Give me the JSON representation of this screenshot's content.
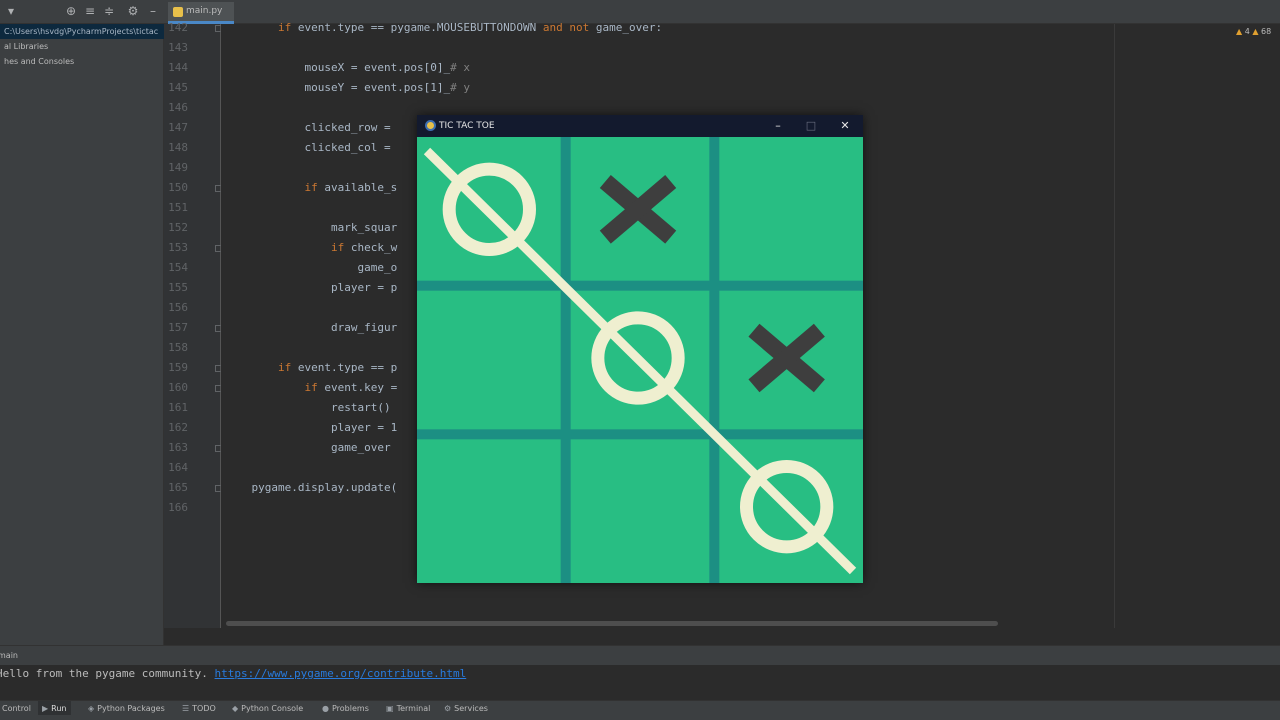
{
  "project_panel": {
    "tree": [
      {
        "label": "C:\\Users\\hsvdg\\PycharmProjects\\tictac",
        "selected": true
      },
      {
        "label": "al Libraries",
        "selected": false
      },
      {
        "label": "hes and Consoles",
        "selected": false
      }
    ]
  },
  "editor": {
    "tab_label": "main.py",
    "warnings": "4",
    "weak_warnings": "68",
    "lines": [
      {
        "n": "142",
        "html": "        <span class=\"kw\">if</span> event.type == pygame.MOUSEBUTTONDOWN <span class=\"kw\">and not</span> game_over:",
        "fold": true
      },
      {
        "n": "143",
        "html": "",
        "fold": false
      },
      {
        "n": "144",
        "html": "            mouseX = event.pos[0]_<span class=\"cm\"># x</span>",
        "fold": false
      },
      {
        "n": "145",
        "html": "            mouseY = event.pos[1]_<span class=\"cm\"># y</span>",
        "fold": false
      },
      {
        "n": "146",
        "html": "",
        "fold": false
      },
      {
        "n": "147",
        "html": "            clicked_row = ",
        "fold": false
      },
      {
        "n": "148",
        "html": "            clicked_col = ",
        "fold": false
      },
      {
        "n": "149",
        "html": "",
        "fold": false
      },
      {
        "n": "150",
        "html": "            <span class=\"kw\">if</span> available_s",
        "fold": true
      },
      {
        "n": "151",
        "html": "",
        "fold": false
      },
      {
        "n": "152",
        "html": "                mark_squar",
        "fold": false
      },
      {
        "n": "153",
        "html": "                <span class=\"kw\">if</span> check_w",
        "fold": true
      },
      {
        "n": "154",
        "html": "                    game_o",
        "fold": false
      },
      {
        "n": "155",
        "html": "                player = p",
        "fold": false
      },
      {
        "n": "156",
        "html": "",
        "fold": false
      },
      {
        "n": "157",
        "html": "                draw_figur",
        "fold": true
      },
      {
        "n": "158",
        "html": "",
        "fold": false
      },
      {
        "n": "159",
        "html": "        <span class=\"kw\">if</span> event.type == p",
        "fold": true
      },
      {
        "n": "160",
        "html": "            <span class=\"kw\">if</span> event.key =",
        "fold": true
      },
      {
        "n": "161",
        "html": "                restart()",
        "fold": false
      },
      {
        "n": "162",
        "html": "                player = 1",
        "fold": false
      },
      {
        "n": "163",
        "html": "                game_over ",
        "fold": true
      },
      {
        "n": "164",
        "html": "",
        "fold": false
      },
      {
        "n": "165",
        "html": "    pygame.display.update(",
        "fold": true
      },
      {
        "n": "166",
        "html": "",
        "fold": false
      }
    ]
  },
  "run_panel": {
    "tab_label": "main",
    "output_text": "Hello from the pygame community. ",
    "output_link": "https://www.pygame.org/contribute.html"
  },
  "tool_windows": [
    {
      "label": "Control",
      "icon": "version-control-icon",
      "active": false
    },
    {
      "label": "Run",
      "icon": "run-icon",
      "active": true
    },
    {
      "label": "Python Packages",
      "icon": "packages-icon",
      "active": false
    },
    {
      "label": "TODO",
      "icon": "todo-icon",
      "active": false
    },
    {
      "label": "Python Console",
      "icon": "python-console-icon",
      "active": false
    },
    {
      "label": "Problems",
      "icon": "problems-icon",
      "active": false
    },
    {
      "label": "Terminal",
      "icon": "terminal-icon",
      "active": false
    },
    {
      "label": "Services",
      "icon": "services-icon",
      "active": false
    }
  ],
  "game": {
    "title": "TIC TAC TOE",
    "board": [
      [
        "O",
        "X",
        ""
      ],
      [
        "",
        "O",
        "X"
      ],
      [
        "",
        "",
        "O"
      ]
    ],
    "win_line": "diagonal-main",
    "colors": {
      "background": "#28be83",
      "grid": "#1c8f83",
      "circle": "#efefd0",
      "cross": "#3e3e3e",
      "win_line": "#efefd0"
    }
  }
}
